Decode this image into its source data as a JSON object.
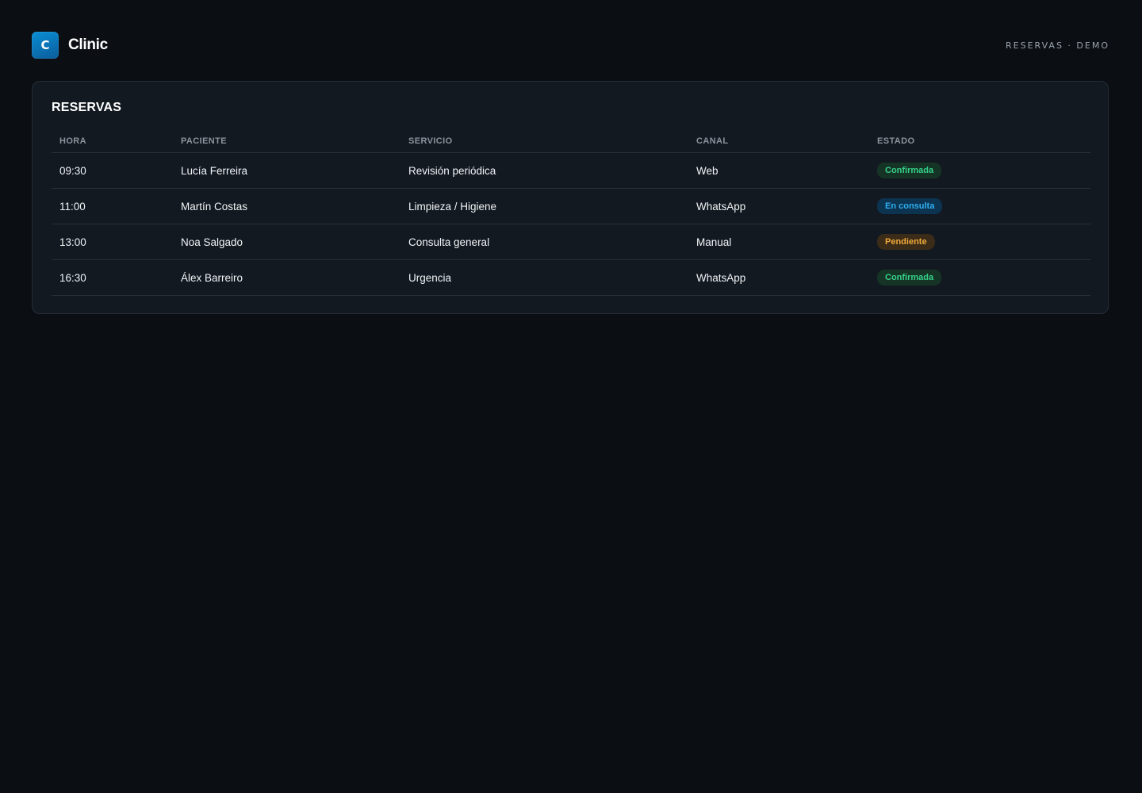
{
  "header": {
    "logo_letter": "C",
    "brand": "Clinic",
    "tag": "RESERVAS · DEMO"
  },
  "reservas": {
    "title": "RESERVAS",
    "columns": [
      "HORA",
      "PACIENTE",
      "SERVICIO",
      "CANAL",
      "ESTADO"
    ],
    "rows": [
      {
        "hora": "09:30",
        "paciente": "Lucía Ferreira",
        "servicio": "Revisión periódica",
        "canal": "Web",
        "estado": "Confirmada",
        "estado_key": "confirmada"
      },
      {
        "hora": "11:00",
        "paciente": "Martín Costas",
        "servicio": "Limpieza / Higiene",
        "canal": "WhatsApp",
        "estado": "En consulta",
        "estado_key": "consulta"
      },
      {
        "hora": "13:00",
        "paciente": "Noa Salgado",
        "servicio": "Consulta general",
        "canal": "Manual",
        "estado": "Pendiente",
        "estado_key": "pendiente"
      },
      {
        "hora": "16:30",
        "paciente": "Álex Barreiro",
        "servicio": "Urgencia",
        "canal": "WhatsApp",
        "estado": "Confirmada",
        "estado_key": "confirmada"
      }
    ]
  },
  "colors": {
    "background": "#0b0e13",
    "card": "#121921",
    "accent": "#0a8fd6",
    "confirmada": "#35d08a",
    "consulta": "#2eaef0",
    "pendiente": "#f0a83a"
  }
}
